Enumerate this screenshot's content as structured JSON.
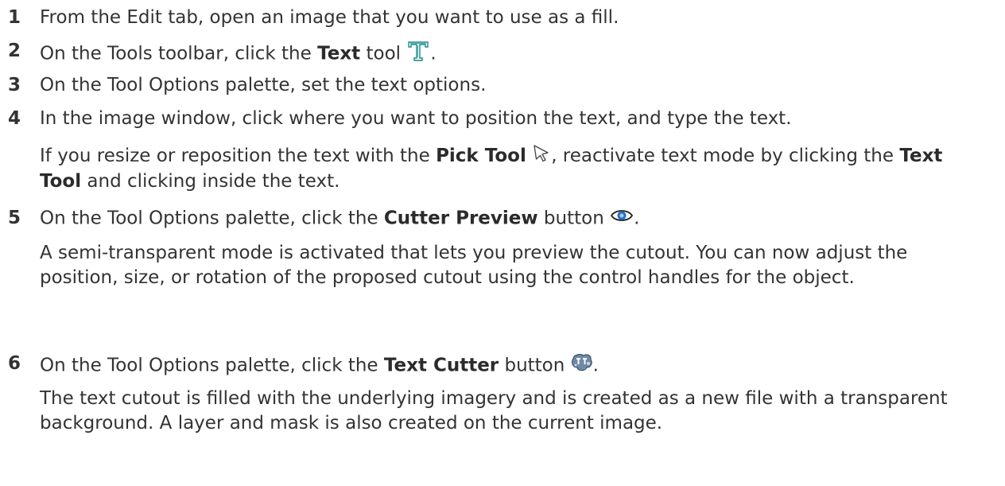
{
  "steps": [
    {
      "num": "1",
      "t1": "From the Edit tab, open an image that you want to use as a fill."
    },
    {
      "num": "2",
      "t1": "On the Tools toolbar, click the ",
      "b1": "Text",
      "t2": " tool",
      "t3": ".",
      "icon": "text-tool-icon"
    },
    {
      "num": "3",
      "t1": "On the Tool Options palette, set the text options."
    },
    {
      "num": "4",
      "t1": "In the image window, click where you want to position the text, and type the text."
    },
    {
      "num": "5",
      "t1": "On the Tool Options palette, click the ",
      "b1": "Cutter Preview",
      "t2": " button",
      "t3": ".",
      "icon": "eye-icon"
    },
    {
      "num": "6",
      "t1": "On the Tool Options palette, click the ",
      "b1": "Text Cutter",
      "t2": " button",
      "t3": ".",
      "icon": "text-cutter-icon"
    }
  ],
  "notes": {
    "step4": {
      "t1": "If you resize or reposition the text with the ",
      "b1": "Pick Tool",
      "t2": ", reactivate text mode by clicking the ",
      "b2": "Text Tool",
      "t3": " and clicking inside the text.",
      "icon": "pick-tool-icon"
    },
    "step5": "A semi-transparent mode is activated that lets you preview the cutout. You can now adjust the position, size, or rotation of the proposed cutout using the control handles for the object.",
    "step6": "The text cutout is filled with the underlying imagery and is created as a new file with a transparent background. A layer and mask is also created on the current image."
  },
  "colors": {
    "text": "#333333",
    "icon_blue": "#2f6fbf",
    "icon_teal": "#1a8a8a"
  }
}
